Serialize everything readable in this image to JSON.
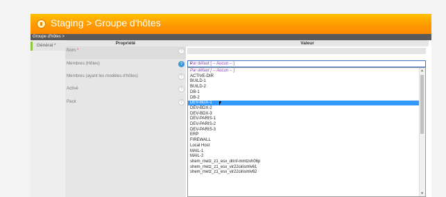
{
  "app": {
    "title": "Staging > Groupe d'hôtes",
    "breadcrumb": "Groupe d'hôtes >"
  },
  "sidebar": {
    "tabs": [
      {
        "label": "Général *"
      }
    ]
  },
  "table": {
    "headers": {
      "property": "Propriété",
      "value": "Valeur"
    },
    "rows": [
      {
        "label": "Nom",
        "required": "*"
      },
      {
        "label": "Membres (Hôtes)"
      },
      {
        "label": "Membres (ayant les modèles d'hôtes)"
      },
      {
        "label": "Activé"
      },
      {
        "label": "Pack"
      }
    ],
    "help_glyph": "?"
  },
  "members_select": {
    "selected": "Par défaut [ -- Aucun -- ]",
    "caret": "▾",
    "options": [
      "Par défaut [ -- Aucun -- ]",
      "ACTIVE-DIR",
      "BUILD-1",
      "BUILD-2",
      "DB-1",
      "DB-2",
      "DEV-BDX-1",
      "DEV-BDX-2",
      "DEV-BDX-3",
      "DEV-PARIS-1",
      "DEV-PARIS-2",
      "DEV-PARIS-3",
      "ERP",
      "FIREWALL",
      "Local Host",
      "MAIL-1",
      "MAIL-2",
      "shem_metz_z1_esx_drinf-mmtzvh06p",
      "shem_metz_z1_esx_vir22cirismlv61",
      "shem_metz_z1_esx_vir22cirismlv62"
    ],
    "highlighted_index": 6,
    "scroll_up": "▲",
    "scroll_down": "▼"
  },
  "colors": {
    "header_orange": "#ff9a00",
    "highlight_blue": "#3399ff",
    "default_option_purple": "#8e44ad",
    "tab_accent_green": "#8ec63f"
  }
}
